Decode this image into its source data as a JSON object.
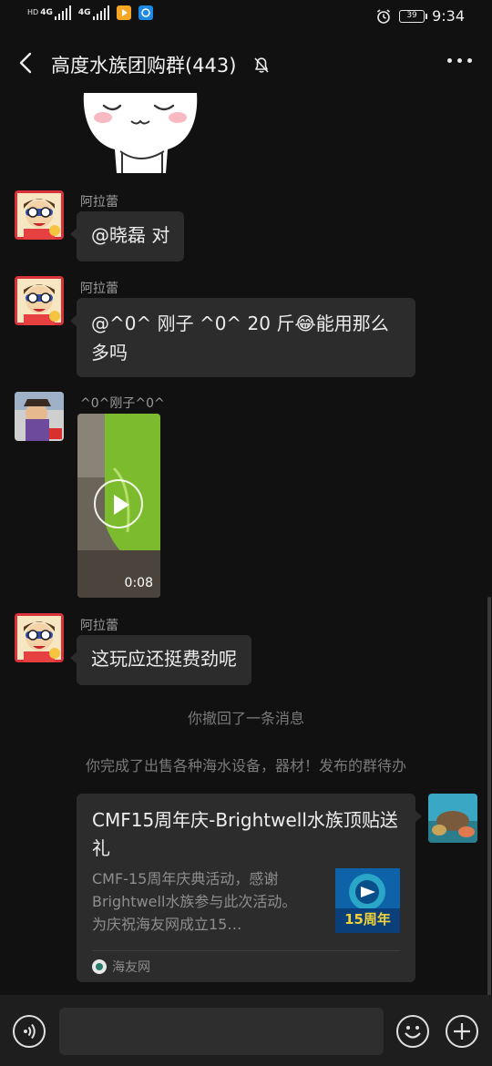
{
  "status_bar": {
    "network_hd": "HD",
    "network_gen": "4G",
    "battery": "39",
    "time": "9:34"
  },
  "header": {
    "title": "高度水族团购群(443)"
  },
  "messages": {
    "msg1": {
      "sender": "阿拉蕾",
      "text": "@晓磊  对"
    },
    "msg2": {
      "sender": "阿拉蕾",
      "text": "@^0^ 刚子 ^0^ 20 斤😂能用那么多吗"
    },
    "msg3": {
      "sender": "^0^刚子^0^",
      "video_duration": "0:08"
    },
    "msg4": {
      "sender": "阿拉蕾",
      "text": "这玩应还挺费劲呢"
    }
  },
  "system": {
    "recall": "你撤回了一条消息",
    "todo": "你完成了出售各种海水设备，器材！发布的群待办"
  },
  "card": {
    "title": "CMF15周年庆-Brightwell水族顶贴送礼",
    "description": "CMF-15周年庆典活动，感谢Brightwell水族参与此次活动。为庆祝海友网成立15…",
    "thumb_text": "15周年",
    "source": "海友网"
  },
  "colors": {
    "background": "#111111",
    "bubble": "#2c2c2c",
    "accent_orange": "#f5a623",
    "accent_blue": "#1e88e5"
  }
}
